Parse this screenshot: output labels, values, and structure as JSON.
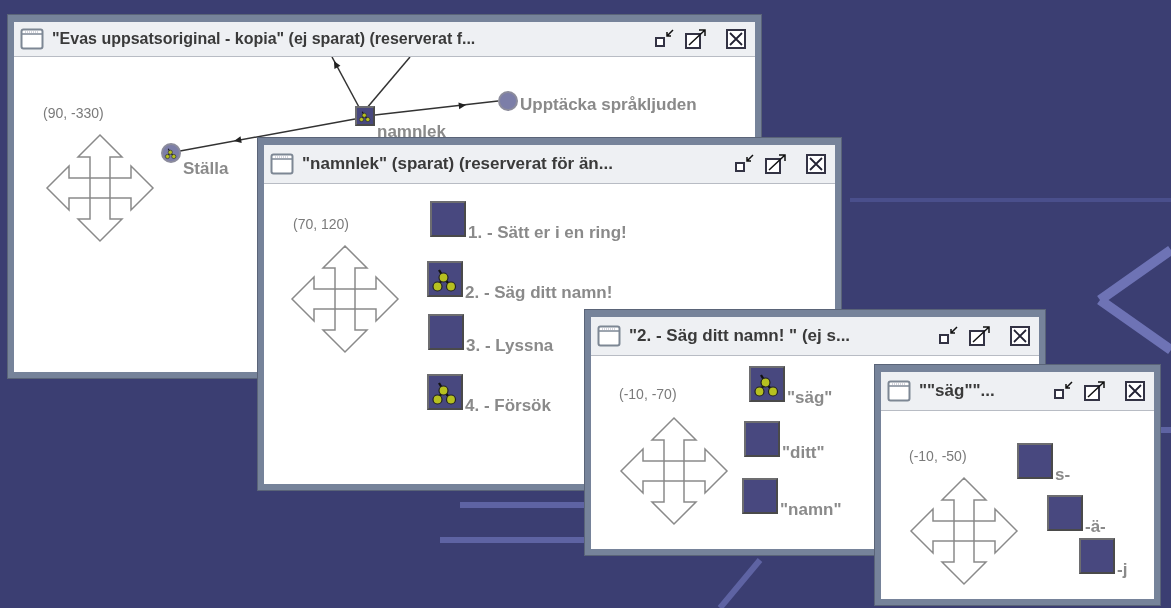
{
  "desktop": {
    "windows": [
      {
        "title": "\"Evas uppsatsoriginal - kopia\" (ej sparat) (reserverat f...",
        "coordinates": "(90, -330)",
        "nodes": [
          {
            "kind": "square",
            "has_children": true,
            "label": "namnlek"
          },
          {
            "kind": "circle",
            "has_children": false,
            "label": "Upptäcka språkljuden"
          },
          {
            "kind": "circle",
            "has_children": true,
            "label": "Ställa"
          }
        ]
      },
      {
        "title": "\"namnlek\" (sparat) (reserverat för än...",
        "coordinates": "(70, 120)",
        "nodes": [
          {
            "kind": "square",
            "has_children": false,
            "label": "1. - Sätt er i en ring!"
          },
          {
            "kind": "square",
            "has_children": true,
            "label": "2. - Säg ditt namn!"
          },
          {
            "kind": "square",
            "has_children": false,
            "label": "3. - Lyssna"
          },
          {
            "kind": "square",
            "has_children": true,
            "label": "4. - Försök"
          }
        ]
      },
      {
        "title": "\"2. - Säg ditt namn! \" (ej s...",
        "coordinates": "(-10, -70)",
        "nodes": [
          {
            "kind": "square",
            "has_children": true,
            "label": "\"säg\""
          },
          {
            "kind": "square",
            "has_children": false,
            "label": "\"ditt\""
          },
          {
            "kind": "square",
            "has_children": false,
            "label": "\"namn\""
          }
        ]
      },
      {
        "title": "\"\"säg\"\"...",
        "coordinates": "(-10, -50)",
        "nodes": [
          {
            "kind": "square",
            "has_children": false,
            "label": "s-"
          },
          {
            "kind": "square",
            "has_children": false,
            "label": "-ä-"
          },
          {
            "kind": "square",
            "has_children": false,
            "label": "-j"
          }
        ]
      }
    ]
  }
}
